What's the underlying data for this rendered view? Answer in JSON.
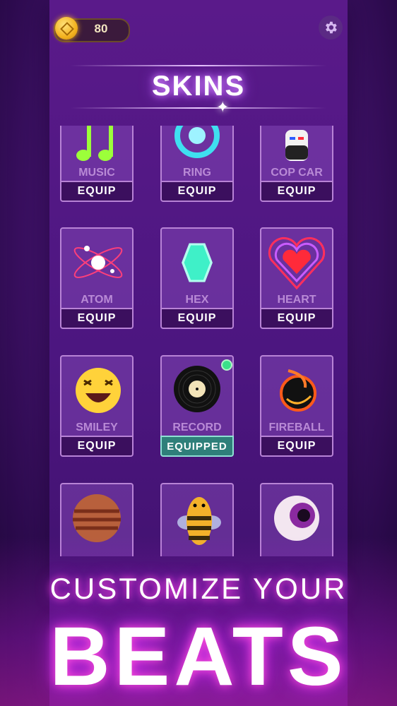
{
  "header": {
    "coins": "80"
  },
  "page_title": "SKINS",
  "skins": [
    {
      "name": "MUSIC NOTE",
      "button": "EQUIP"
    },
    {
      "name": "RING",
      "button": "EQUIP"
    },
    {
      "name": "COP CAR",
      "button": "EQUIP"
    },
    {
      "name": "ATOM",
      "button": "EQUIP"
    },
    {
      "name": "HEX",
      "button": "EQUIP"
    },
    {
      "name": "HEART",
      "button": "EQUIP"
    },
    {
      "name": "SMILEY",
      "button": "EQUIP"
    },
    {
      "name": "RECORD",
      "button": "EQUIPPED"
    },
    {
      "name": "FIREBALL",
      "button": "EQUIP"
    }
  ],
  "promo": {
    "line1": "CUSTOMIZE YOUR",
    "line2": "BEATS"
  },
  "colors": {
    "accent": "#b34dff",
    "equipped": "#2f7f7a",
    "coin": "#f3b21f"
  }
}
